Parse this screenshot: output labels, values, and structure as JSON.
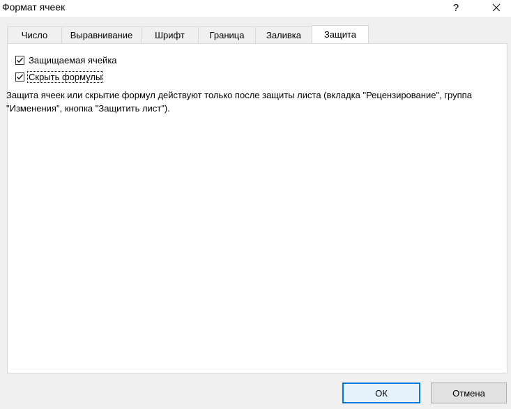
{
  "window": {
    "title": "Формат ячеек",
    "help_label": "?"
  },
  "tabs": [
    {
      "label": "Число"
    },
    {
      "label": "Выравнивание"
    },
    {
      "label": "Шрифт"
    },
    {
      "label": "Граница"
    },
    {
      "label": "Заливка"
    },
    {
      "label": "Защита",
      "active": true
    }
  ],
  "protection": {
    "locked": {
      "label": "Защищаемая ячейка",
      "checked": true
    },
    "hidden": {
      "label": "Скрыть формулы",
      "checked": true
    },
    "info": "Защита ячеек или скрытие формул действуют только после защиты листа (вкладка \"Рецензирование\", группа \"Изменения\", кнопка \"Защитить лист\")."
  },
  "buttons": {
    "ok": "ОК",
    "cancel": "Отмена"
  },
  "colors": {
    "accent": "#0078d7",
    "tab_border": "#d9d9d9"
  }
}
